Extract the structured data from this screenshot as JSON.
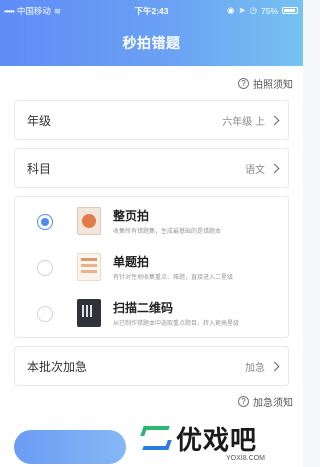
{
  "status_bar": {
    "carrier": "中国移动",
    "time": "下午2:43",
    "battery": "75%",
    "battery_level": 0.75
  },
  "header": {
    "title": "秒拍错题"
  },
  "links": {
    "photo_help": "拍照须知",
    "urgent_help": "加急须知"
  },
  "fields": {
    "grade": {
      "label": "年级",
      "value": "六年级 上"
    },
    "subject": {
      "label": "科目",
      "value": "语文"
    },
    "urgent": {
      "label": "本批次加急",
      "value": "加急"
    }
  },
  "options": [
    {
      "title": "整页拍",
      "desc": "收集所有错题集，生成最基础的是错题本",
      "selected": true,
      "icon": "page-photo-icon"
    },
    {
      "title": "单题拍",
      "desc": "有针对性地收集重点、难题，直接进入二星级",
      "selected": false,
      "icon": "single-question-icon"
    },
    {
      "title": "扫描二维码",
      "desc": "从已制作错题本中选取重点题目，转入更高星级",
      "selected": false,
      "icon": "qr-code-icon"
    }
  ],
  "watermark": {
    "text": "优戏吧",
    "url": "YOXI8.COM"
  }
}
